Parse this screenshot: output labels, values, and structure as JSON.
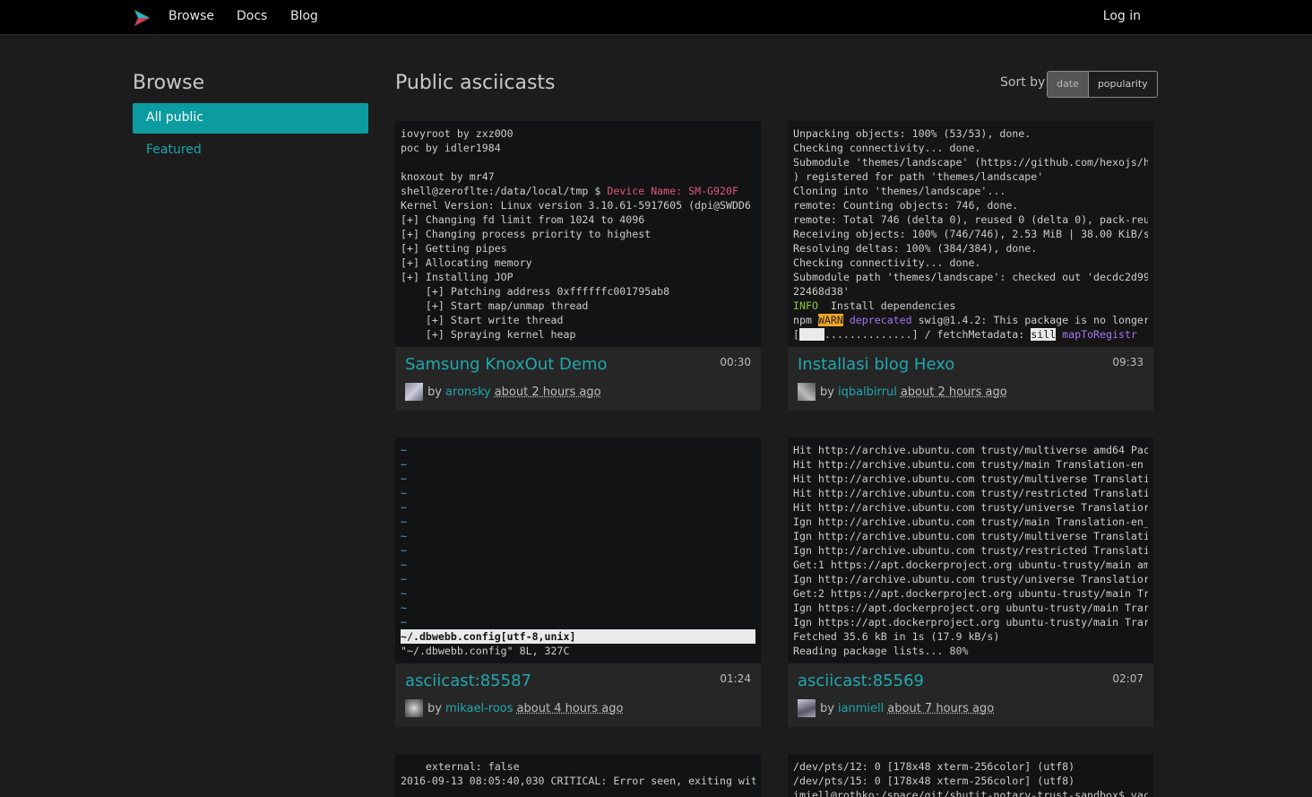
{
  "nav": {
    "logo_icon": "asciinema-play-icon",
    "links": [
      "Browse",
      "Docs",
      "Blog"
    ],
    "login": "Log in"
  },
  "sidebar": {
    "title": "Browse",
    "items": [
      {
        "label": "All public",
        "active": true
      },
      {
        "label": "Featured",
        "active": false
      }
    ]
  },
  "main": {
    "title": "Public asciicasts",
    "sort_label": "Sort by",
    "sort_options": [
      "date",
      "popularity"
    ],
    "sort_selected": "date"
  },
  "colors": {
    "accent": "#0b9ba0",
    "link": "#22a8ae",
    "background": "#1c1c1c",
    "terminal_bg": "#121314"
  },
  "cards": [
    {
      "title": "Samsung KnoxOut Demo",
      "duration": "00:30",
      "by": "by",
      "author": "aronsky",
      "ago": "about 2 hours ago",
      "lines": [
        "iovyroot by zxz0O0",
        "poc by idler1984",
        "",
        "knoxout by mr47",
        "shell@zeroflte:/data/local/tmp $ |Device Name: SM-G920F",
        "Kernel Version: Linux version 3.10.61-5917605 (dpi@SWDD6",
        "[+] Changing fd limit from 1024 to 4096",
        "[+] Changing process priority to highest",
        "[+] Getting pipes",
        "[+] Allocating memory",
        "[+] Installing JOP",
        "    [+] Patching address 0xffffffc001795ab8",
        "    [+] Start map/unmap thread",
        "    [+] Start write thread",
        "    [+] Spraying kernel heap"
      ]
    },
    {
      "title": "Installasi blog Hexo",
      "duration": "09:33",
      "by": "by",
      "author": "iqbalbirrul",
      "ago": "about 2 hours ago",
      "lines": [
        "Unpacking objects: 100% (53/53), done.",
        "Checking connectivity... done.",
        "Submodule 'themes/landscape' (https://github.com/hexojs/h",
        ") registered for path 'themes/landscape'",
        "Cloning into 'themes/landscape'...",
        "remote: Counting objects: 746, done.",
        "remote: Total 746 (delta 0), reused 0 (delta 0), pack-reu",
        "Receiving objects: 100% (746/746), 2.53 MiB | 38.00 KiB/s",
        "Resolving deltas: 100% (384/384), done.",
        "Checking connectivity... done.",
        "Submodule path 'themes/landscape': checked out 'decdc2d99",
        "22468d38'",
        "INFO  Install dependencies",
        "npm WARN deprecated swig@1.4.2: This package is no longer",
        "[    ..............] / fetchMetadata: sill mapToRegistr"
      ]
    },
    {
      "title": "asciicast:85587",
      "duration": "01:24",
      "by": "by",
      "author": "mikael-roos",
      "ago": "about 4 hours ago",
      "lines": [
        "~",
        "~",
        "~",
        "~",
        "~",
        "~",
        "~",
        "~",
        "~",
        "~",
        "~",
        "~",
        "~",
        "~/.dbwebb.config[utf-8,unix]",
        "\"~/.dbwebb.config\" 8L, 327C"
      ]
    },
    {
      "title": "asciicast:85569",
      "duration": "02:07",
      "by": "by",
      "author": "ianmiell",
      "ago": "about 7 hours ago",
      "lines": [
        "Hit http://archive.ubuntu.com trusty/multiverse amd64 Pac",
        "Hit http://archive.ubuntu.com trusty/main Translation-en",
        "Hit http://archive.ubuntu.com trusty/multiverse Translati",
        "Hit http://archive.ubuntu.com trusty/restricted Translati",
        "Hit http://archive.ubuntu.com trusty/universe Translatior",
        "Ign http://archive.ubuntu.com trusty/main Translation-en_",
        "Ign http://archive.ubuntu.com trusty/multiverse Translati",
        "Ign http://archive.ubuntu.com trusty/restricted Translati",
        "Get:1 https://apt.dockerproject.org ubuntu-trusty/main am",
        "Ign http://archive.ubuntu.com trusty/universe Translatior",
        "Get:2 https://apt.dockerproject.org ubuntu-trusty/main Tr",
        "Ign https://apt.dockerproject.org ubuntu-trusty/main Trar",
        "Ign https://apt.dockerproject.org ubuntu-trusty/main Trar",
        "Fetched 35.6 kB in 1s (17.9 kB/s)",
        "Reading package lists... 80%"
      ]
    },
    {
      "lines": [
        "    external: false",
        "2016-09-13 08:05:40,030 CRITICAL: Error seen, exiting wit"
      ]
    },
    {
      "lines": [
        "/dev/pts/12: 0 [178x48 xterm-256color] (utf8)",
        "/dev/pts/15: 0 [178x48 xterm-256color] (utf8)",
        "imiell@rothko:/space/git/shutit-notary-trust-sandbox$ vac"
      ]
    }
  ]
}
